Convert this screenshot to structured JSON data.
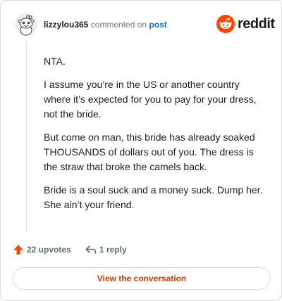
{
  "header": {
    "username": "lizzylou365",
    "commented_text": "commented on",
    "post_link": "post",
    "brand_name": "reddit"
  },
  "comment": {
    "paragraphs": [
      "NTA.",
      "I assume you’re in the US or another country where it’s expected for you to pay for your dress, not the bride.",
      "But come on man, this bride has already soaked THOUSANDS of dollars out of you. The dress is the straw that broke the camels back.",
      "Bride is a soul suck and a money suck. Dump her. She ain’t your friend."
    ]
  },
  "actions": {
    "upvotes_label": "22 upvotes",
    "replies_label": "1 reply",
    "view_button_label": "View the conversation"
  },
  "icons": {
    "avatar": "snoo-avatar-icon",
    "logo": "reddit-snoo-icon",
    "upvote": "upvote-arrow-icon",
    "reply": "reply-arrow-icon"
  },
  "colors": {
    "brand_orange": "#ff4500",
    "link_blue": "#0079d3",
    "button_text": "#d93a00",
    "muted": "#576f76"
  }
}
